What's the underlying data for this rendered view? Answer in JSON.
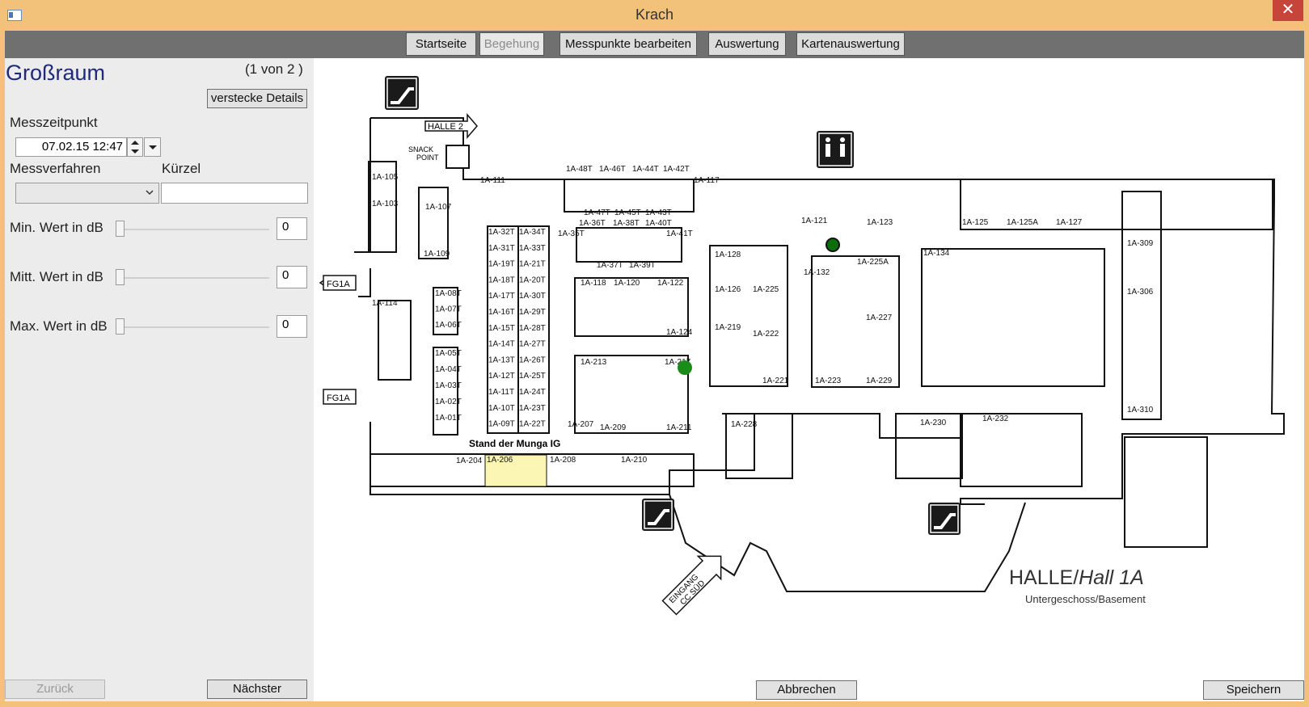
{
  "window": {
    "title": "Krach",
    "close_glyph": "✕"
  },
  "tabs": [
    {
      "label": "Startseite",
      "active": false
    },
    {
      "label": "Begehung",
      "active": true
    },
    {
      "label": "Messpunkte bearbeiten",
      "active": false
    },
    {
      "label": "Auswertung",
      "active": false
    },
    {
      "label": "Kartenauswertung",
      "active": false
    }
  ],
  "panel": {
    "title": "Großraum",
    "counter": "(1 von 2 )",
    "details_button": "verstecke Details",
    "messzeitpunkt_label": "Messzeitpunkt",
    "messzeitpunkt_value": "07.02.15 12:47",
    "messverfahren_label": "Messverfahren",
    "kuerzel_label": "Kürzel",
    "messverfahren_value": "",
    "kuerzel_value": "",
    "min_label": "Min. Wert in dB",
    "min_value": "0",
    "mitt_label": "Mitt. Wert in dB",
    "mitt_value": "0",
    "max_label": "Max. Wert in dB",
    "max_value": "0",
    "back_button": "Zurück",
    "next_button": "Nächster"
  },
  "footer": {
    "cancel_button": "Abbrechen",
    "save_button": "Speichern"
  },
  "map": {
    "title_halle": "HALLE/",
    "title_hall": "Hall 1A",
    "subtitle": "Untergeschoss/Basement",
    "stand_label": "Stand der Munga IG",
    "halle2_label": "HALLE 2",
    "snack_label_1": "SNACK",
    "snack_label_2": "POINT",
    "fg1a_top": "FG1A",
    "fg1a_bottom": "FG1A",
    "eingang": "EINGANG",
    "cc_sued": "CC SÜD",
    "rooms": {
      "r105": "1A-105",
      "r103": "1A-103",
      "r107": "1A-107",
      "r109": "1A-109",
      "r111": "1A-111",
      "r117": "1A-117",
      "r114": "1A-114",
      "r118": "1A-118",
      "r120": "1A-120",
      "r122": "1A-122",
      "r124": "1A-124",
      "r128": "1A-128",
      "r126": "1A-126",
      "r225": "1A-225",
      "r219": "1A-219",
      "r222": "1A-222",
      "r221": "1A-221",
      "r121": "1A-121",
      "r123": "1A-123",
      "r125": "1A-125",
      "r125a": "1A-125A",
      "r127": "1A-127",
      "r132": "1A-132",
      "r225a": "1A-225A",
      "r227": "1A-227",
      "r223": "1A-223",
      "r229": "1A-229",
      "r134": "1A-134",
      "r309": "1A-309",
      "r306": "1A-306",
      "r310": "1A-310",
      "r213": "1A-213",
      "r217": "1A-217",
      "r207": "1A-207",
      "r209": "1A-209",
      "r211": "1A-211",
      "r228": "1A-228",
      "r230": "1A-230",
      "r232": "1A-232",
      "r204": "1A-204",
      "r206": "1A-206",
      "r208": "1A-208",
      "r210": "1A-210",
      "r35t": "1A-35T",
      "r41t": "1A-41T",
      "r37t": "1A-37T",
      "r39t": "1A-39T",
      "r48t": "1A-48T",
      "r46t": "1A-46T",
      "r44t": "1A-44T",
      "r42t": "1A-42T",
      "r47t": "1A-47T",
      "r45t": "1A-45T",
      "r43t": "1A-43T",
      "r36t": "1A-36T",
      "r38t": "1A-38T",
      "r40t": "1A-40T"
    },
    "booths_left": [
      "1A-32T",
      "1A-31T",
      "1A-19T",
      "1A-18T",
      "1A-17T",
      "1A-16T",
      "1A-15T",
      "1A-14T",
      "1A-13T",
      "1A-12T",
      "1A-11T",
      "1A-10T",
      "1A-09T"
    ],
    "booths_right": [
      "1A-34T",
      "1A-33T",
      "1A-21T",
      "1A-20T",
      "1A-30T",
      "1A-29T",
      "1A-28T",
      "1A-27T",
      "1A-26T",
      "1A-25T",
      "1A-24T",
      "1A-23T",
      "1A-22T"
    ],
    "booths_small_a": [
      "1A-08T",
      "1A-07T",
      "1A-06T"
    ],
    "booths_small_b": [
      "1A-05T",
      "1A-04T",
      "1A-03T",
      "1A-02T",
      "1A-01T"
    ],
    "marker_colors": {
      "active": "#0a6e0a",
      "point": "#1a8c1a",
      "highlight": "#fbf6b4"
    }
  },
  "icons": [
    "escalator-icon",
    "restroom-icon",
    "snack-icon",
    "elevator-icon",
    "dropdown-icon",
    "spinner-icon"
  ]
}
